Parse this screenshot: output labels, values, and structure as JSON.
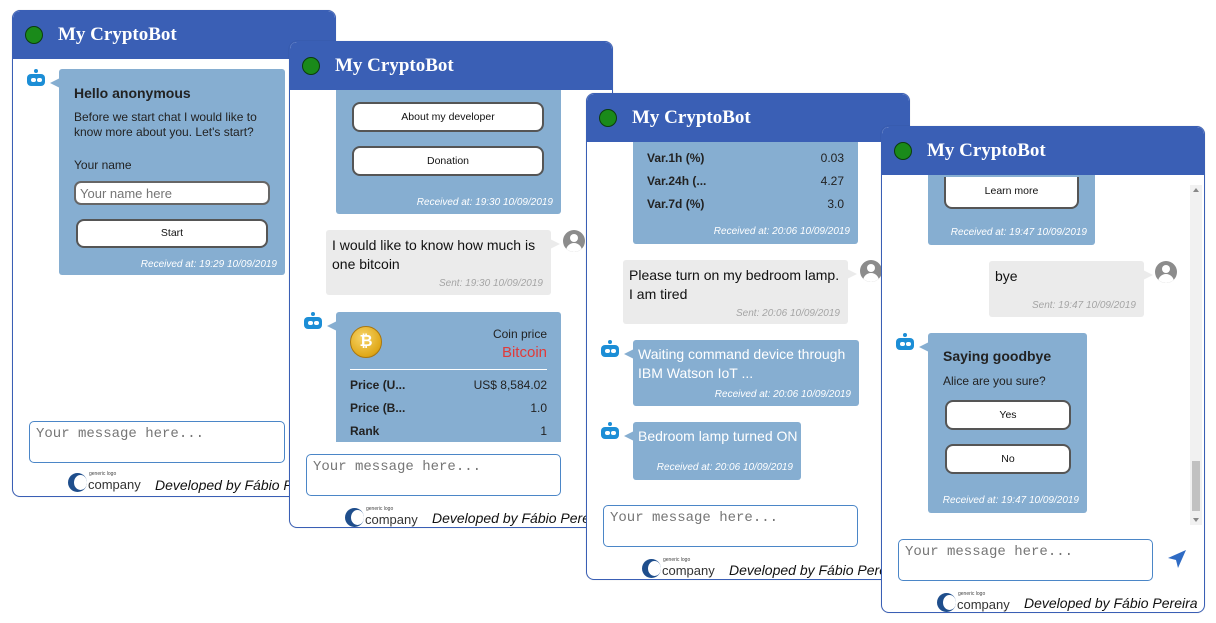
{
  "app_title": "My CryptoBot",
  "message_placeholder": "Your message here...",
  "footer": {
    "developer": "Developed by Fábio Pereira",
    "logo_small": "generic logo",
    "logo_big": "company"
  },
  "colors": {
    "header": "#3a5fb5",
    "bot_bubble": "#86aed1",
    "user_bubble": "#ebebeb",
    "status_online": "#1a8a1a",
    "coin_price_red": "#e03a3a"
  },
  "window1": {
    "greeting_title": "Hello anonymous",
    "greeting_text": "Before we start chat I would like to know more about you. Let's start?",
    "name_label": "Your name",
    "name_placeholder": "Your name here",
    "start_button": "Start",
    "received": "Received at: 19:29 10/09/2019"
  },
  "window2": {
    "about_button": "About my developer",
    "donation_button": "Donation",
    "received1": "Received at: 19:30 10/09/2019",
    "user_message": "I would like to know how much is one bitcoin",
    "sent": "Sent: 19:30 10/09/2019",
    "coin_price_label": "Coin price",
    "coin_name": "Bitcoin",
    "coin_symbol": "₿",
    "rows": [
      {
        "label": "Price (U...",
        "value": "US$ 8,584.02"
      },
      {
        "label": "Price (B...",
        "value": "1.0"
      },
      {
        "label": "Rank",
        "value": "1"
      }
    ]
  },
  "window3": {
    "rows": [
      {
        "label": "Var.1h (%)",
        "value": "0.03"
      },
      {
        "label": "Var.24h (...",
        "value": "4.27"
      },
      {
        "label": "Var.7d (%)",
        "value": "3.0"
      }
    ],
    "received1": "Received at: 20:06 10/09/2019",
    "user_message": "Please turn on my bedroom lamp. I am tired",
    "sent": "Sent: 20:06 10/09/2019",
    "bot_message1": "Waiting command device through IBM Watson IoT ...",
    "received2": "Received at: 20:06 10/09/2019",
    "bot_message2": "Bedroom lamp turned ON",
    "received3": "Received at: 20:06 10/09/2019"
  },
  "window4": {
    "learn_more_button": "Learn more",
    "received1": "Received at: 19:47 10/09/2019",
    "user_message": "bye",
    "sent": "Sent: 19:47 10/09/2019",
    "goodbye_title": "Saying goodbye",
    "goodbye_question": "Alice are you sure?",
    "yes_button": "Yes",
    "no_button": "No",
    "received2": "Received at: 19:47 10/09/2019"
  }
}
